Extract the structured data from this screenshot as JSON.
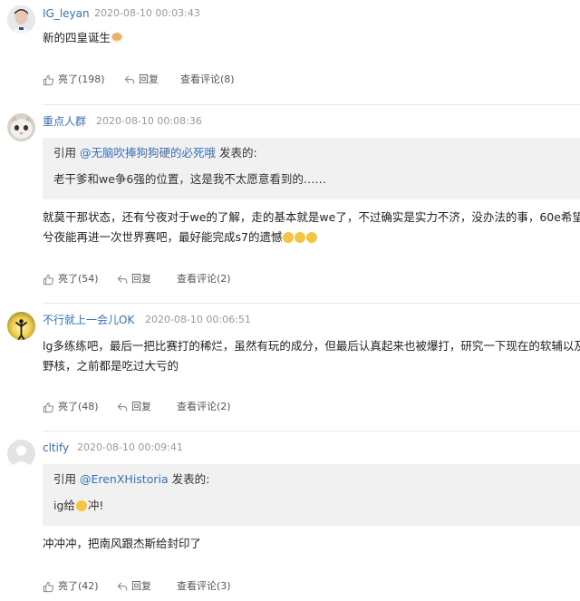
{
  "comments": [
    {
      "username": "IG_leyan",
      "time": "2020-08-10 00:03:43",
      "body": "新的四皇诞生",
      "emoji": "🐶",
      "quote": null,
      "likes": "亮了(198)",
      "reply": "回复",
      "view": "查看评论(8)"
    },
    {
      "username": "重点人群",
      "time": "2020-08-10 00:08:36",
      "quote": {
        "prefix": "引用 ",
        "user": "@无脑吹捧狗狗硬的必死哦",
        "suffix": " 发表的:",
        "text": "老干爹和we争6强的位置，这是我不太愿意看到的……"
      },
      "body_line1": "就莫干那状态，还有兮夜对于we的了解，走的基本就是we了，不过确实是实力不济，没办法的事，60e希望",
      "body_line2": "兮夜能再进一次世界赛吧，最好能完成s7的遗憾",
      "emoji": "😭😭😭",
      "likes": "亮了(54)",
      "reply": "回复",
      "view": "查看评论(2)"
    },
    {
      "username": "不行就上一会儿OK",
      "time": "2020-08-10 00:06:51",
      "quote": null,
      "body_line1": "lg多练练吧，最后一把比赛打的稀烂，虽然有玩的成分，但最后认真起来也被爆打，研究一下现在的软辅以及",
      "body_line2": "野核，之前都是吃过大亏的",
      "likes": "亮了(48)",
      "reply": "回复",
      "view": "查看评论(2)"
    },
    {
      "username": "cltify",
      "time": "2020-08-10 00:09:41",
      "quote": {
        "prefix": "引用 ",
        "user": "@ErenXHistoria",
        "suffix": " 发表的:",
        "text_pre": "ig给",
        "emoji": "😊",
        "text_post": "冲!"
      },
      "body": "冲冲冲，把南风跟杰斯给封印了",
      "likes": "亮了(42)",
      "reply": "回复",
      "view": "查看评论(3)"
    }
  ],
  "icons": {
    "like": "thumbs-up-icon",
    "reply": "reply-icon",
    "view": "comment-bubble-icon"
  },
  "colors": {
    "username": "#3b6fb6",
    "quote_bg": "#f1f1f1",
    "time": "#999999"
  }
}
